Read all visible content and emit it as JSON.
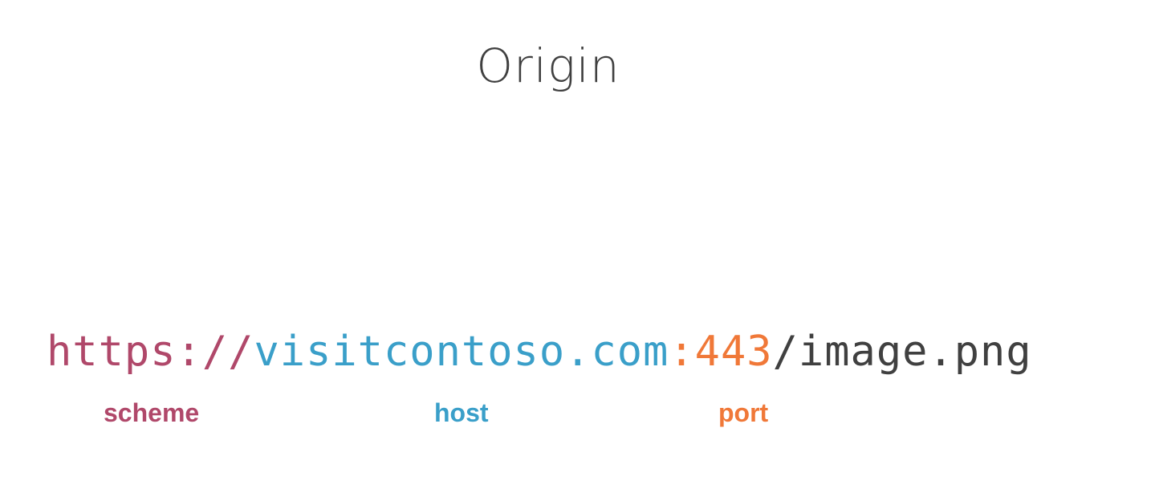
{
  "title": "Origin",
  "url": {
    "scheme": "https://",
    "host": "visitcontoso.com",
    "port": ":443",
    "path": "/image.png"
  },
  "labels": {
    "scheme": "scheme",
    "host": "host",
    "port": "port"
  },
  "colors": {
    "title": "#404040",
    "scheme": "#b0486a",
    "host": "#3a9fc9",
    "port": "#f07838",
    "path": "#404040"
  }
}
